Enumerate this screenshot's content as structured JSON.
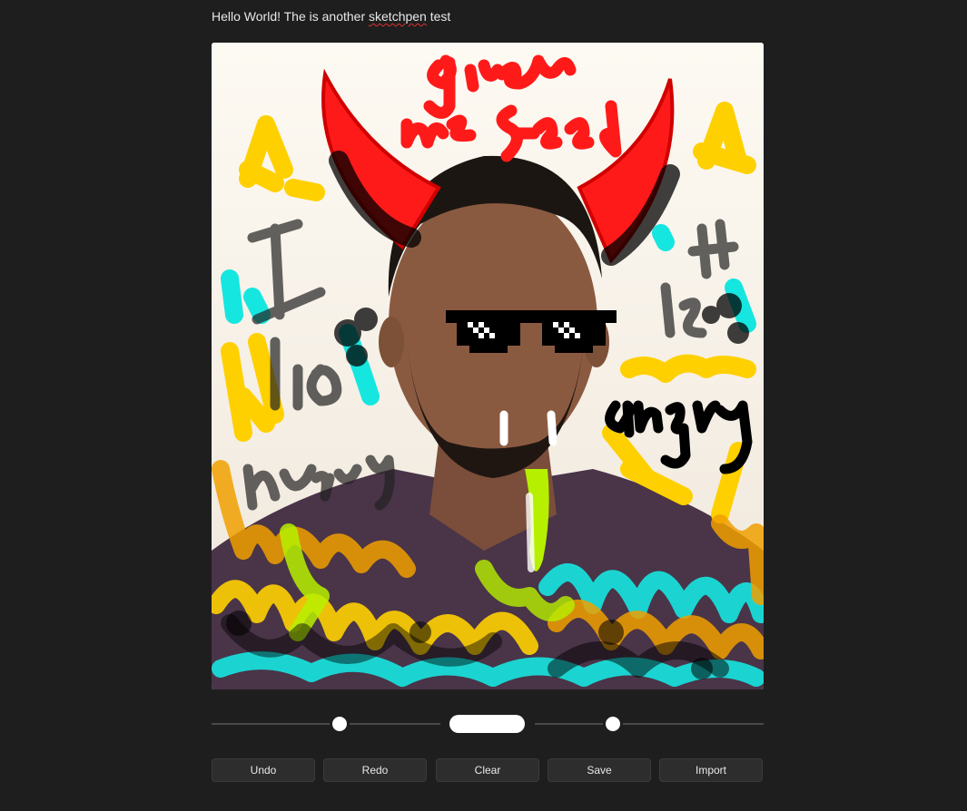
{
  "heading": {
    "before": "Hello World! The is another ",
    "misspelled": "sketchpen",
    "after": " test"
  },
  "canvas": {
    "drawn_text": [
      "give me food",
      "I hungry",
      "is angry"
    ]
  },
  "controls": {
    "stroke_size_level": 0.56,
    "opacity_level": 0.34,
    "pen_color": "#ffffff"
  },
  "buttons": {
    "undo": "Undo",
    "redo": "Redo",
    "clear": "Clear",
    "save": "Save",
    "import": "Import"
  },
  "colors": {
    "background": "#1e1e1e",
    "button_bg": "#2d2d2d",
    "red": "#ff1a1a",
    "yellow": "#ffd000",
    "cyan": "#16e6e0",
    "orange": "#f0a000",
    "lime": "#b6f000",
    "black": "#000000"
  }
}
